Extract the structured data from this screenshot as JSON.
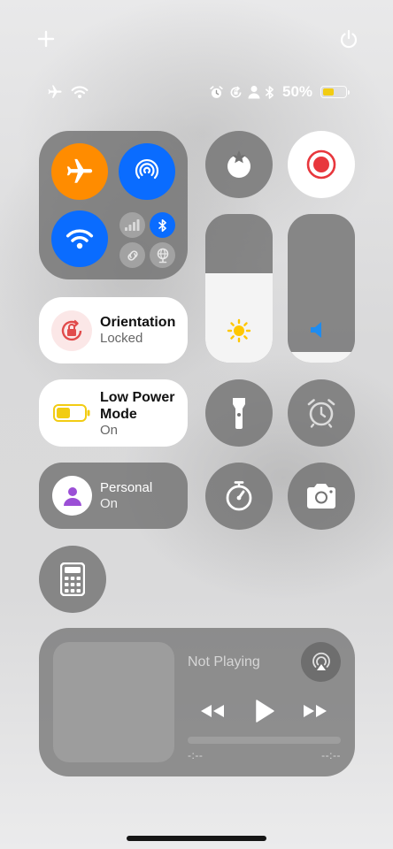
{
  "status_bar": {
    "battery_percent_label": "50%",
    "battery_level": 0.5,
    "battery_color": "#f2cc13",
    "left_icons": [
      "airplane-icon",
      "wifi-icon"
    ],
    "right_icons": [
      "alarm-icon",
      "rotation-lock-icon",
      "person-icon",
      "bluetooth-icon"
    ]
  },
  "top_controls": [
    "add-icon",
    "power-icon"
  ],
  "connectivity": {
    "airplane_mode": {
      "state": "on",
      "color": "#ff8c00"
    },
    "airdrop": {
      "state": "on",
      "color": "#0a6cff"
    },
    "wifi": {
      "state": "on",
      "color": "#0a6cff"
    },
    "cellular": {
      "state": "off"
    },
    "bluetooth": {
      "state": "on",
      "color": "#0a6cff"
    },
    "hotspot": {
      "state": "off"
    },
    "vpn": {
      "state": "off"
    }
  },
  "orientation_lock": {
    "title": "Orientation",
    "status": "Locked",
    "accent": "#e14b4b"
  },
  "low_power": {
    "title": "Low Power Mode",
    "status": "On",
    "accent": "#f2cc13"
  },
  "focus": {
    "title": "Personal",
    "status": "On",
    "accent": "#9b4fd6"
  },
  "sliders": {
    "brightness": {
      "level": 0.6,
      "icon": "sun-icon",
      "icon_color": "#ffc700"
    },
    "volume": {
      "level": 0.07,
      "icon": "speaker-icon",
      "icon_color": "#1e8cf0"
    }
  },
  "buttons": [
    "focus-moon-icon",
    "screen-record-icon",
    "flashlight-icon",
    "alarm-icon",
    "timer-icon",
    "camera-icon",
    "calculator-icon"
  ],
  "screen_record": {
    "color": "#e8373d"
  },
  "now_playing": {
    "title": "Not Playing",
    "elapsed": "-:--",
    "remaining": "--:--"
  }
}
